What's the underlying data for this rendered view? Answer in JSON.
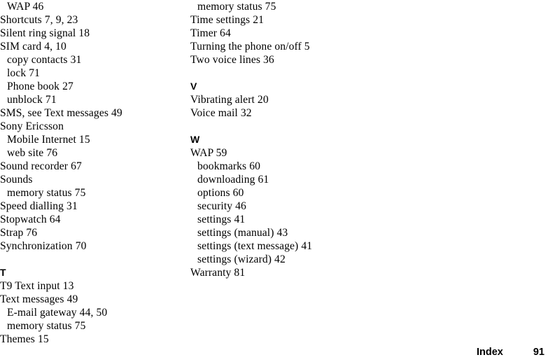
{
  "document": {
    "type": "index-page",
    "footer": {
      "label": "Index",
      "page_number": "91"
    }
  },
  "index": {
    "left_column": [
      {
        "kind": "sub",
        "text": "WAP 46"
      },
      {
        "kind": "entry",
        "text": "Shortcuts 7, 9, 23"
      },
      {
        "kind": "entry",
        "text": "Silent ring signal 18"
      },
      {
        "kind": "entry",
        "text": "SIM card 4, 10"
      },
      {
        "kind": "sub",
        "text": "copy contacts 31"
      },
      {
        "kind": "sub",
        "text": "lock 71"
      },
      {
        "kind": "sub",
        "text": "Phone book 27"
      },
      {
        "kind": "sub",
        "text": "unblock 71"
      },
      {
        "kind": "entry",
        "text": "SMS, see Text messages 49"
      },
      {
        "kind": "entry",
        "text": "Sony Ericsson"
      },
      {
        "kind": "sub",
        "text": "Mobile Internet 15"
      },
      {
        "kind": "sub",
        "text": "web site 76"
      },
      {
        "kind": "entry",
        "text": "Sound recorder 67"
      },
      {
        "kind": "entry",
        "text": "Sounds"
      },
      {
        "kind": "sub",
        "text": "memory status 75"
      },
      {
        "kind": "entry",
        "text": "Speed dialling 31"
      },
      {
        "kind": "entry",
        "text": "Stopwatch 64"
      },
      {
        "kind": "entry",
        "text": "Strap 76"
      },
      {
        "kind": "entry",
        "text": "Synchronization 70"
      },
      {
        "kind": "spacer",
        "text": ""
      },
      {
        "kind": "section",
        "text": "T"
      },
      {
        "kind": "entry",
        "text": "T9 Text input 13"
      },
      {
        "kind": "entry",
        "text": "Text messages 49"
      },
      {
        "kind": "sub",
        "text": "E-mail gateway 44, 50"
      },
      {
        "kind": "sub",
        "text": "memory status 75"
      },
      {
        "kind": "entry",
        "text": "Themes 15"
      }
    ],
    "right_column": [
      {
        "kind": "sub",
        "text": "memory status 75"
      },
      {
        "kind": "entry",
        "text": "Time settings 21"
      },
      {
        "kind": "entry",
        "text": "Timer 64"
      },
      {
        "kind": "entry",
        "text": "Turning the phone on/off 5"
      },
      {
        "kind": "entry",
        "text": "Two voice lines 36"
      },
      {
        "kind": "spacer",
        "text": ""
      },
      {
        "kind": "section",
        "text": "V"
      },
      {
        "kind": "entry",
        "text": "Vibrating alert 20"
      },
      {
        "kind": "entry",
        "text": "Voice mail 32"
      },
      {
        "kind": "spacer",
        "text": ""
      },
      {
        "kind": "section",
        "text": "W"
      },
      {
        "kind": "entry",
        "text": "WAP 59"
      },
      {
        "kind": "sub",
        "text": "bookmarks 60"
      },
      {
        "kind": "sub",
        "text": "downloading 61"
      },
      {
        "kind": "sub",
        "text": "options 60"
      },
      {
        "kind": "sub",
        "text": "security 46"
      },
      {
        "kind": "sub",
        "text": "settings 41"
      },
      {
        "kind": "sub",
        "text": "settings (manual) 43"
      },
      {
        "kind": "sub",
        "text": "settings (text message) 41"
      },
      {
        "kind": "sub",
        "text": "settings (wizard) 42"
      },
      {
        "kind": "entry",
        "text": "Warranty 81"
      }
    ]
  }
}
